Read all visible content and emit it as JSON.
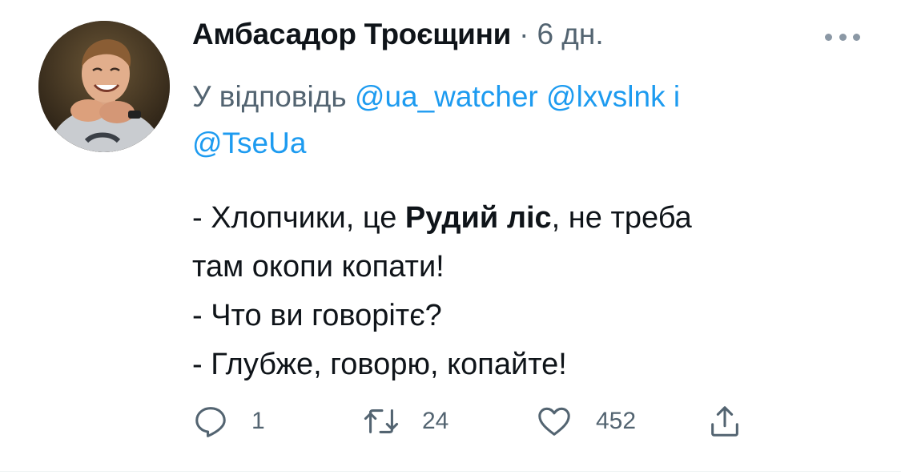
{
  "tweet": {
    "author_name": "Амбасадор Троєщини",
    "meta_separator": "·",
    "timestamp": "6 дн.",
    "reply_prefix": "У відповідь",
    "reply_mentions": [
      "@ua_watcher",
      "@lxvslnk"
    ],
    "reply_conjunction": "і",
    "reply_last_mention": "@TseUa",
    "body_lines": [
      {
        "a": "- Хлопчики, це ",
        "bold": "Рудий ліс",
        "b": ", не треба"
      },
      {
        "a": "там окопи копати!"
      },
      {
        "a": "- Что ви говорітє?"
      },
      {
        "a": "- Глубже, говорю, копайте!"
      }
    ],
    "actions": {
      "reply_count": "1",
      "retweet_count": "24",
      "like_count": "452",
      "reply_icon": "reply-icon",
      "retweet_icon": "retweet-icon",
      "like_icon": "heart-icon",
      "share_icon": "share-icon"
    },
    "more_icon": "more-options-icon"
  },
  "colors": {
    "text_primary": "#0f1419",
    "text_secondary": "#536471",
    "accent": "#1d9bf0"
  }
}
